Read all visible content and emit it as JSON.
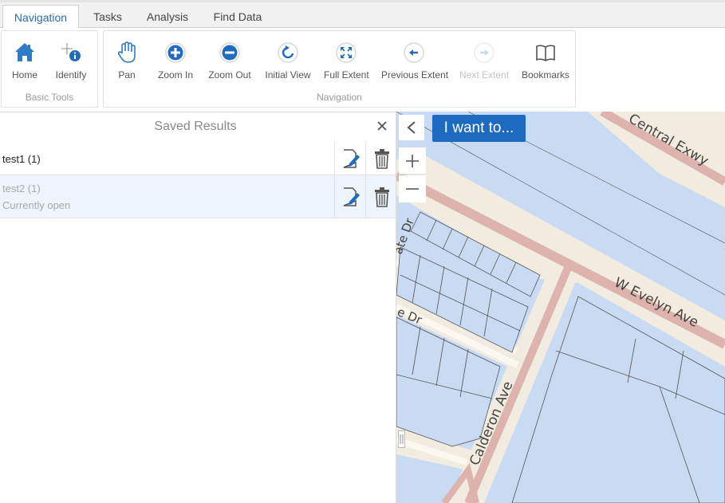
{
  "tabs": [
    {
      "label": "Navigation",
      "active": true
    },
    {
      "label": "Tasks",
      "active": false
    },
    {
      "label": "Analysis",
      "active": false
    },
    {
      "label": "Find Data",
      "active": false
    }
  ],
  "ribbon": {
    "basic_tools": {
      "caption": "Basic Tools",
      "tools": [
        {
          "label": "Home",
          "icon": "home-icon"
        },
        {
          "label": "Identify",
          "icon": "identify-icon"
        }
      ]
    },
    "navigation": {
      "caption": "Navigation",
      "tools": [
        {
          "label": "Pan",
          "icon": "hand-icon",
          "enabled": true
        },
        {
          "label": "Zoom In",
          "icon": "plus-circle-icon",
          "enabled": true
        },
        {
          "label": "Zoom Out",
          "icon": "minus-circle-icon",
          "enabled": true
        },
        {
          "label": "Initial View",
          "icon": "refresh-icon",
          "enabled": true
        },
        {
          "label": "Full Extent",
          "icon": "expand-icon",
          "enabled": true
        },
        {
          "label": "Previous Extent",
          "icon": "arrow-left-circle-icon",
          "enabled": true
        },
        {
          "label": "Next Extent",
          "icon": "arrow-right-circle-icon",
          "enabled": false
        },
        {
          "label": "Bookmarks",
          "icon": "book-icon",
          "enabled": true
        }
      ]
    }
  },
  "panel": {
    "title": "Saved Results",
    "results": [
      {
        "name": "test1 (1)",
        "status": ""
      },
      {
        "name": "test2 (1)",
        "status": "Currently open"
      }
    ]
  },
  "map": {
    "i_want_to": "I want to...",
    "streets": {
      "central": "Central Exwy",
      "evelyn": "W Evelyn Ave",
      "calderon": "Calderon Ave",
      "gate": "ate Dr",
      "lower": "e Dr"
    },
    "colors": {
      "land": "#f2ece0",
      "water_parcels": "#c9daf3",
      "road": "#dcb3ad",
      "accent": "#1c6bc1"
    }
  }
}
